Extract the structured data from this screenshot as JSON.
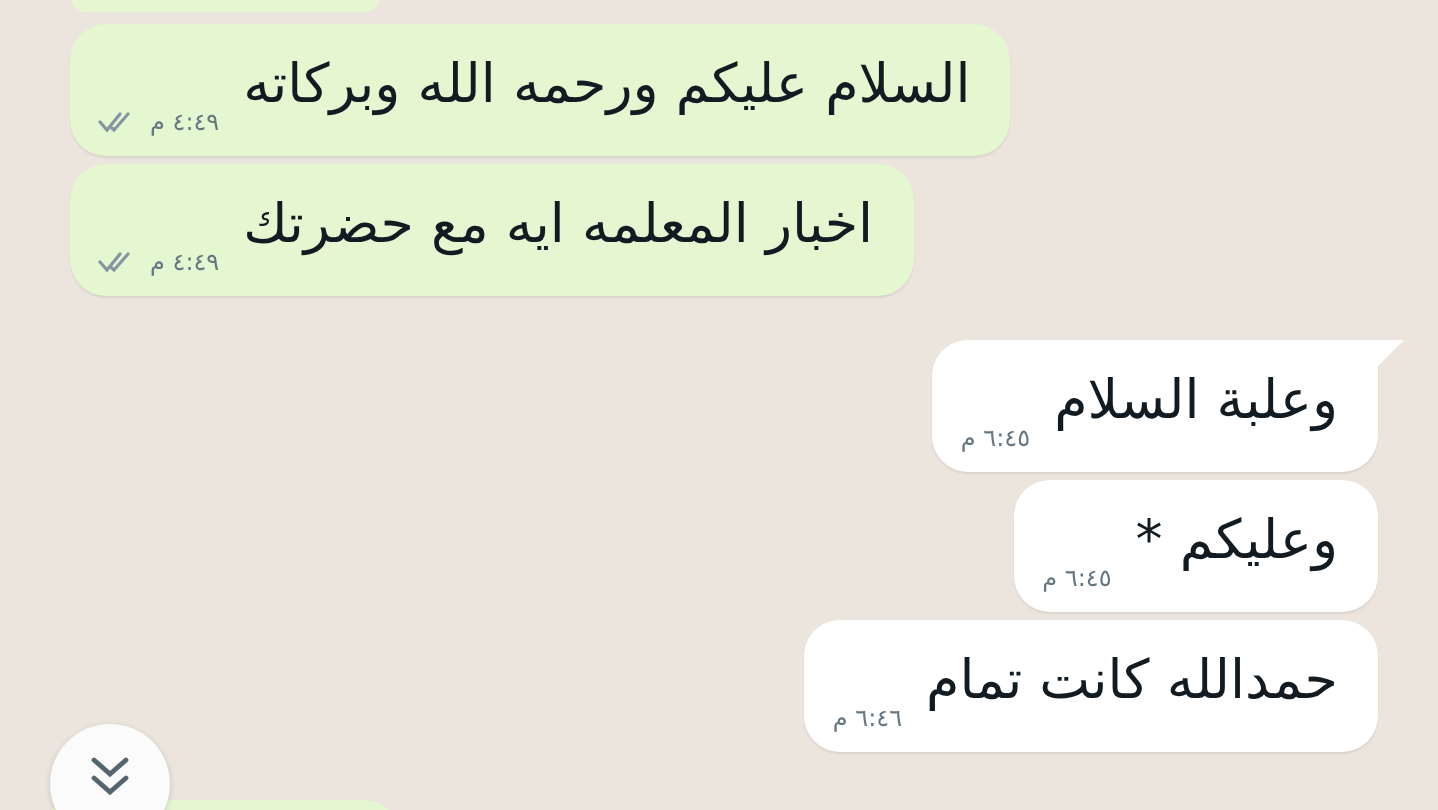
{
  "messages": [
    {
      "outgoing": true,
      "text": "السلام عليكم ورحمه الله وبركاته",
      "time": "٤:٤٩ م",
      "read": false,
      "tail": false
    },
    {
      "outgoing": true,
      "text": "اخبار المعلمه ايه مع حضرتك",
      "time": "٤:٤٩ م",
      "read": false,
      "tail": false
    },
    {
      "outgoing": false,
      "text": "وعلبة السلام",
      "time": "٦:٤٥ م",
      "tail": true
    },
    {
      "outgoing": false,
      "text": "وعليكم *",
      "time": "٦:٤٥ م",
      "tail": false
    },
    {
      "outgoing": false,
      "text": "حمدالله كانت تمام",
      "time": "٦:٤٦ م",
      "tail": false
    }
  ]
}
